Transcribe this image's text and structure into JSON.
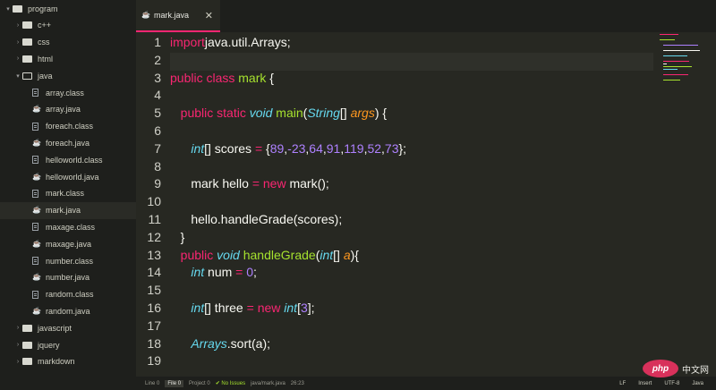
{
  "sidebar": {
    "items": [
      {
        "label": "program",
        "kind": "folder",
        "open": true,
        "depth": 0,
        "selected": false
      },
      {
        "label": "c++",
        "kind": "folder",
        "open": false,
        "depth": 1,
        "selected": false
      },
      {
        "label": "css",
        "kind": "folder",
        "open": false,
        "depth": 1,
        "selected": false
      },
      {
        "label": "html",
        "kind": "folder",
        "open": false,
        "depth": 1,
        "selected": false
      },
      {
        "label": "java",
        "kind": "folder",
        "open": true,
        "depth": 1,
        "selected": false
      },
      {
        "label": "array.class",
        "kind": "file",
        "depth": 2,
        "selected": false
      },
      {
        "label": "array.java",
        "kind": "java",
        "depth": 2,
        "selected": false
      },
      {
        "label": "foreach.class",
        "kind": "file",
        "depth": 2,
        "selected": false
      },
      {
        "label": "foreach.java",
        "kind": "java",
        "depth": 2,
        "selected": false
      },
      {
        "label": "helloworld.class",
        "kind": "file",
        "depth": 2,
        "selected": false
      },
      {
        "label": "helloworld.java",
        "kind": "java",
        "depth": 2,
        "selected": false
      },
      {
        "label": "mark.class",
        "kind": "file",
        "depth": 2,
        "selected": false
      },
      {
        "label": "mark.java",
        "kind": "java",
        "depth": 2,
        "selected": true
      },
      {
        "label": "maxage.class",
        "kind": "file",
        "depth": 2,
        "selected": false
      },
      {
        "label": "maxage.java",
        "kind": "java",
        "depth": 2,
        "selected": false
      },
      {
        "label": "number.class",
        "kind": "file",
        "depth": 2,
        "selected": false
      },
      {
        "label": "number.java",
        "kind": "java",
        "depth": 2,
        "selected": false
      },
      {
        "label": "random.class",
        "kind": "file",
        "depth": 2,
        "selected": false
      },
      {
        "label": "random.java",
        "kind": "java",
        "depth": 2,
        "selected": false
      },
      {
        "label": "javascript",
        "kind": "folder",
        "open": false,
        "depth": 1,
        "selected": false
      },
      {
        "label": "jquery",
        "kind": "folder",
        "open": false,
        "depth": 1,
        "selected": false
      },
      {
        "label": "markdown",
        "kind": "folder",
        "open": false,
        "depth": 1,
        "selected": false
      }
    ]
  },
  "tab": {
    "label": "mark.java",
    "close": "✕"
  },
  "editor": {
    "lines": [
      {
        "n": "1",
        "tokens": [
          [
            "kw",
            "import"
          ],
          [
            "",
            "java.util.Arrays;"
          ]
        ]
      },
      {
        "n": "2",
        "tokens": []
      },
      {
        "n": "3",
        "tokens": [
          [
            "kw",
            "public class"
          ],
          [
            "",
            " "
          ],
          [
            "fn",
            "mark"
          ],
          [
            "",
            " {"
          ]
        ]
      },
      {
        "n": "4",
        "tokens": []
      },
      {
        "n": "5",
        "tokens": [
          [
            "",
            "   "
          ],
          [
            "kw",
            "public static"
          ],
          [
            "",
            " "
          ],
          [
            "ty",
            "void"
          ],
          [
            "",
            " "
          ],
          [
            "fn",
            "main"
          ],
          [
            "",
            "("
          ],
          [
            "ty",
            "String"
          ],
          [
            "",
            "[] "
          ],
          [
            "par",
            "args"
          ],
          [
            "",
            ") {"
          ]
        ]
      },
      {
        "n": "6",
        "tokens": []
      },
      {
        "n": "7",
        "tokens": [
          [
            "",
            "      "
          ],
          [
            "ty",
            "int"
          ],
          [
            "",
            "[] scores "
          ],
          [
            "kw",
            "="
          ],
          [
            "",
            " {"
          ],
          [
            "num",
            "89"
          ],
          [
            "",
            ","
          ],
          [
            "num",
            "-23"
          ],
          [
            "",
            ","
          ],
          [
            "num",
            "64"
          ],
          [
            "",
            ","
          ],
          [
            "num",
            "91"
          ],
          [
            "",
            ","
          ],
          [
            "num",
            "119"
          ],
          [
            "",
            ","
          ],
          [
            "num",
            "52"
          ],
          [
            "",
            ","
          ],
          [
            "num",
            "73"
          ],
          [
            "",
            "};"
          ]
        ]
      },
      {
        "n": "8",
        "tokens": []
      },
      {
        "n": "9",
        "tokens": [
          [
            "",
            "      mark hello "
          ],
          [
            "kw",
            "="
          ],
          [
            "",
            " "
          ],
          [
            "kw",
            "new"
          ],
          [
            "",
            " mark();"
          ]
        ]
      },
      {
        "n": "10",
        "tokens": []
      },
      {
        "n": "11",
        "tokens": [
          [
            "",
            "      hello.handleGrade(scores);"
          ]
        ]
      },
      {
        "n": "12",
        "tokens": [
          [
            "",
            "   }"
          ]
        ]
      },
      {
        "n": "13",
        "tokens": [
          [
            "",
            "   "
          ],
          [
            "kw",
            "public"
          ],
          [
            "",
            " "
          ],
          [
            "ty",
            "void"
          ],
          [
            "",
            " "
          ],
          [
            "fn",
            "handleGrade"
          ],
          [
            "",
            "("
          ],
          [
            "ty",
            "int"
          ],
          [
            "",
            "[] "
          ],
          [
            "par",
            "a"
          ],
          [
            "",
            "){"
          ]
        ]
      },
      {
        "n": "14",
        "tokens": [
          [
            "",
            "      "
          ],
          [
            "ty",
            "int"
          ],
          [
            "",
            " num "
          ],
          [
            "kw",
            "="
          ],
          [
            "",
            " "
          ],
          [
            "num",
            "0"
          ],
          [
            "",
            ";"
          ]
        ]
      },
      {
        "n": "15",
        "tokens": []
      },
      {
        "n": "16",
        "tokens": [
          [
            "",
            "      "
          ],
          [
            "ty",
            "int"
          ],
          [
            "",
            "[] three "
          ],
          [
            "kw",
            "="
          ],
          [
            "",
            " "
          ],
          [
            "kw",
            "new"
          ],
          [
            "",
            " "
          ],
          [
            "ty",
            "int"
          ],
          [
            "",
            "["
          ],
          [
            "num",
            "3"
          ],
          [
            "",
            "];"
          ]
        ]
      },
      {
        "n": "17",
        "tokens": []
      },
      {
        "n": "18",
        "tokens": [
          [
            "",
            "      "
          ],
          [
            "ty",
            "Arrays"
          ],
          [
            "",
            ".sort(a);"
          ]
        ]
      },
      {
        "n": "19",
        "tokens": []
      }
    ],
    "current_line": "2"
  },
  "statusbar": {
    "line": "Line 0",
    "file": "File 0",
    "project": "Project 0",
    "issues": "✔ No Issues",
    "path": "java/mark.java",
    "position": "26:23",
    "line_ending": "LF",
    "mode": "Insert",
    "encoding": "UTF-8",
    "grammar": "Java"
  },
  "watermark": {
    "logo": "php",
    "text": "中文网"
  },
  "colors": {
    "keyword": "#f92672",
    "type": "#66d9ef",
    "function": "#a6e22e",
    "number": "#ae81ff",
    "param": "#fd971f",
    "accent": "#f92672"
  }
}
